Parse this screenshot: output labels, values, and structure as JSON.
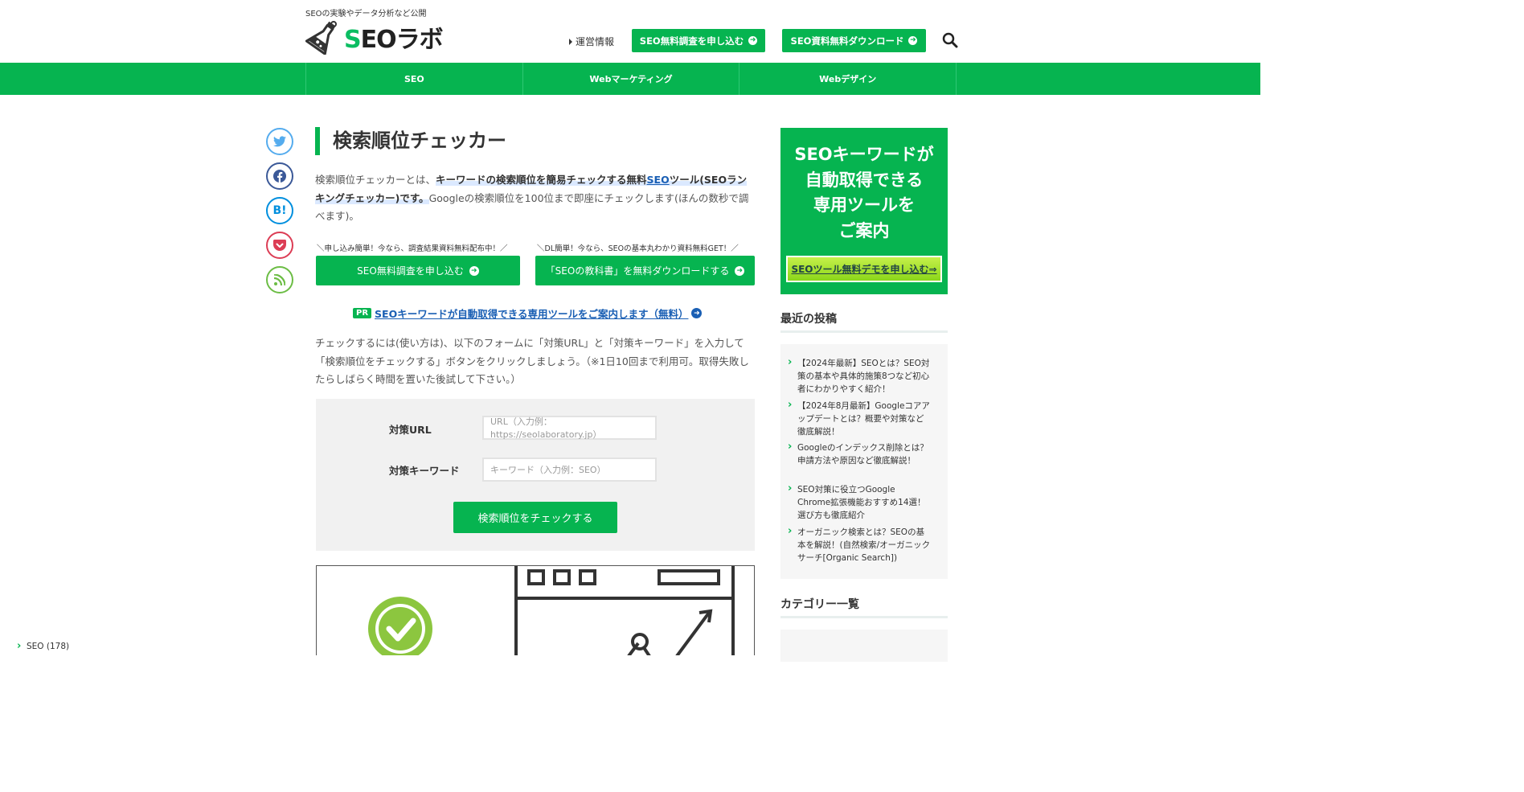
{
  "header": {
    "tagline": "SEOの実験やデータ分析など公開",
    "logo_text": "SEOラボ",
    "link_label": "運営情報",
    "btn1_label": "SEO無料調査を申し込む",
    "btn2_label": "SEO資料無料ダウンロード"
  },
  "nav": {
    "items": [
      {
        "label": "SEO"
      },
      {
        "label": "Webマーケティング"
      },
      {
        "label": "Webデザイン"
      }
    ]
  },
  "share": {
    "hatena_label": "B!"
  },
  "main": {
    "title": "検索順位チェッカー",
    "intro_1": "検索順位チェッカーとは、",
    "intro_bold_1": "キーワードの検索順位を簡易チェックする無料",
    "intro_link": "SEO",
    "intro_bold_2": "ツール(SEOランキングチェッカー)です。",
    "intro_2": "Googleの検索順位を100位まで即座にチェックします(ほんの数秒で調べます)。",
    "cta1_note": "＼申し込み簡単！今なら、調査結果資料無料配布中！／",
    "cta1_label": "SEO無料調査を申し込む",
    "cta2_note": "＼DL簡単！今なら、SEOの基本丸わかり資料無料GET！／",
    "cta2_label": "「SEOの教科書」を無料ダウンロードする",
    "pr_badge": "PR",
    "pr_link": "SEOキーワードが自動取得できる専用ツールをご案内します（無料）",
    "howto": "チェックするには(使い方は)、以下のフォームに「対策URL」と「対策キーワード」を入力して「検索順位をチェックする」ボタンをクリックしましょう。（※1日10回まで利用可。取得失敗したらしばらく時間を置いた後試して下さい。）",
    "form": {
      "url_label": "対策URL",
      "url_placeholder": "URL（入力例：https://seolaboratory.jp）",
      "kw_label": "対策キーワード",
      "kw_placeholder": "キーワード（入力例：SEO）",
      "submit_label": "検索順位をチェックする"
    }
  },
  "sidebar": {
    "banner_line1": "SEOキーワードが",
    "banner_line2": "自動取得できる",
    "banner_line3": "専用ツールを",
    "banner_line4": "ご案内",
    "banner_btn": "SEOツール無料デモを申し込む⇒",
    "recent_heading": "最近の投稿",
    "recent": [
      {
        "label": "【2024年最新】SEOとは？SEO対策の基本や具体的施策8つなど初心者にわかりやすく紹介！"
      },
      {
        "label": "【2024年8月最新】Googleコアアップデートとは？概要や対策など徹底解説！"
      },
      {
        "label": "Googleのインデックス削除とは？申請方法や原因など徹底解説！"
      },
      {
        "label": "SEO対策に役立つGoogle Chrome拡張機能おすすめ14選！選び方も徹底紹介"
      },
      {
        "label": "オーガニック検索とは？SEOの基本を解説！(自然検索/オーガニックサーチ[Organic Search])"
      }
    ],
    "category_heading": "カテゴリー一覧",
    "categories": [
      {
        "label": "SEO (178)"
      }
    ]
  },
  "colors": {
    "brand_green": "#06b450",
    "link_blue": "#1a5fb4"
  }
}
